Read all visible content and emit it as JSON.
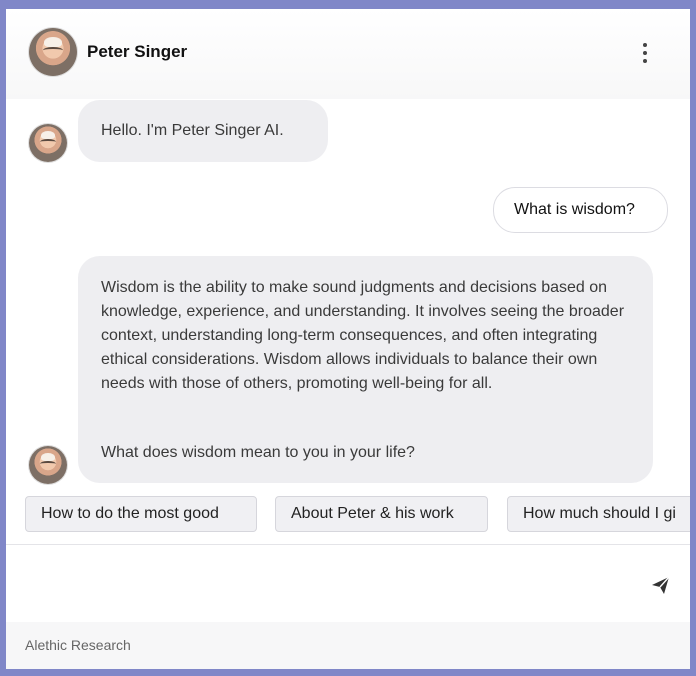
{
  "header": {
    "name": "Peter Singer",
    "avatar_icon": "peter-singer-avatar",
    "menu_icon": "more-vertical-icon"
  },
  "messages": [
    {
      "role": "assistant",
      "text": "Hello. I'm Peter Singer AI."
    },
    {
      "role": "user",
      "text": "What is wisdom?"
    },
    {
      "role": "assistant",
      "paragraphs": [
        "Wisdom is the ability to make sound judgments and decisions based on knowledge, experience, and understanding. It involves seeing the broader context, understanding long-term consequences, and often integrating ethical considerations. Wisdom allows individuals to balance their own needs with those of others, promoting well-being for all.",
        "What does wisdom mean to you in your life?"
      ]
    }
  ],
  "suggestions": [
    "How to do the most good",
    "About Peter & his work",
    "How much should I gi"
  ],
  "composer": {
    "value": "",
    "placeholder": "",
    "send_icon": "send-icon"
  },
  "footer": {
    "text": "Alethic Research"
  },
  "colors": {
    "frame": "#8087c8",
    "bot_bubble": "#eeeef1",
    "chip_bg": "#f0f0f3"
  }
}
